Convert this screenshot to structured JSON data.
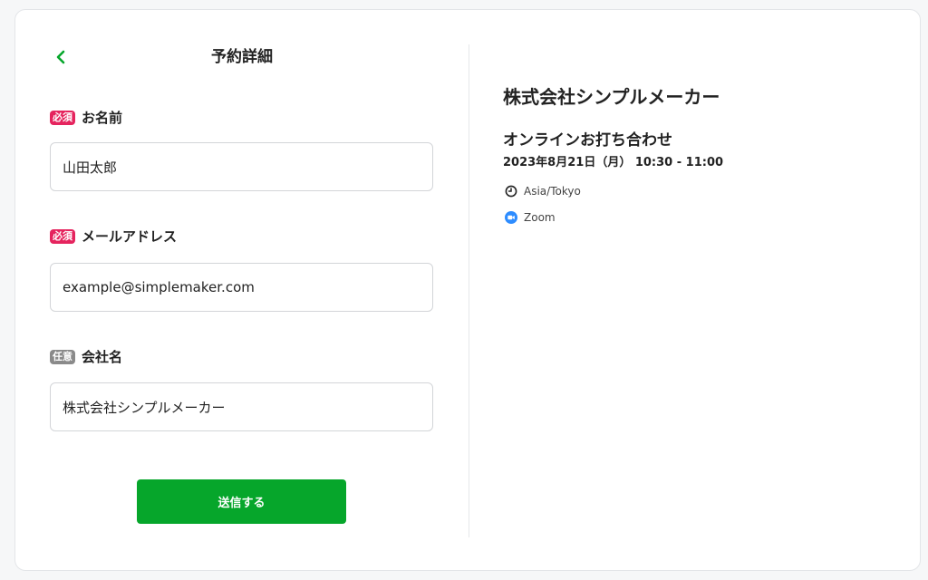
{
  "form": {
    "title": "予約詳細",
    "fields": [
      {
        "badge": "必須",
        "label": "お名前",
        "value": "山田太郎"
      },
      {
        "badge": "必須",
        "label": "メールアドレス",
        "value": "example@simplemaker.com"
      },
      {
        "badge": "任意",
        "label": "会社名",
        "value": "株式会社シンプルメーカー"
      }
    ],
    "submit_label": "送信する"
  },
  "event": {
    "company": "株式会社シンプルメーカー",
    "name": "オンラインお打ち合わせ",
    "datetime": "2023年8月21日（月） 10:30 - 11:00",
    "timezone": "Asia/Tokyo",
    "location": "Zoom"
  },
  "colors": {
    "accent": "#06a62b",
    "required_badge": "#e5245e",
    "optional_badge": "#8a8a8a",
    "zoom": "#2d8cff"
  }
}
